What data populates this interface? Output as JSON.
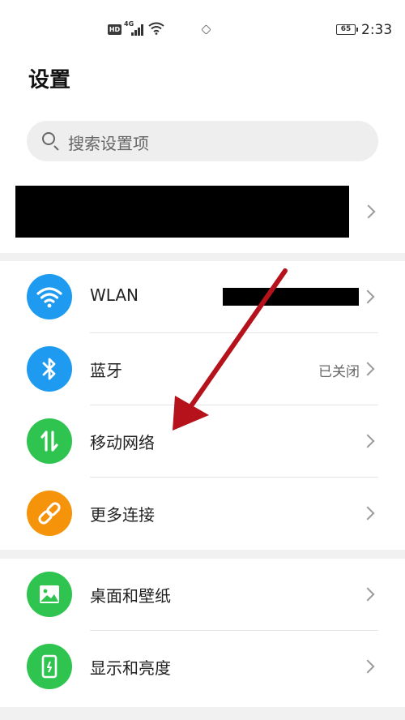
{
  "status_bar": {
    "hd": "HD",
    "network": "4G",
    "battery": "65",
    "time": "2:33"
  },
  "page": {
    "title": "设置"
  },
  "search": {
    "placeholder": "搜索设置项"
  },
  "groups": [
    [
      {
        "id": "wlan",
        "label": "WLAN",
        "value": "",
        "icon": "wifi-icon",
        "color": "#1e9bf0"
      },
      {
        "id": "bluetooth",
        "label": "蓝牙",
        "value": "已关闭",
        "icon": "bluetooth-icon",
        "color": "#1e9bf0"
      },
      {
        "id": "mobile-network",
        "label": "移动网络",
        "value": "",
        "icon": "mobile-data-icon",
        "color": "#2ec44f"
      },
      {
        "id": "more-connections",
        "label": "更多连接",
        "value": "",
        "icon": "link-icon",
        "color": "#f5930a"
      }
    ],
    [
      {
        "id": "wallpaper",
        "label": "桌面和壁纸",
        "value": "",
        "icon": "image-icon",
        "color": "#2ec44f"
      },
      {
        "id": "display",
        "label": "显示和亮度",
        "value": "",
        "icon": "phone-brightness-icon",
        "color": "#2ec44f"
      }
    ]
  ],
  "colors": {
    "accent_blue": "#1e9bf0",
    "accent_green": "#2ec44f",
    "accent_orange": "#f5930a",
    "annotation_arrow": "#b5121b"
  }
}
